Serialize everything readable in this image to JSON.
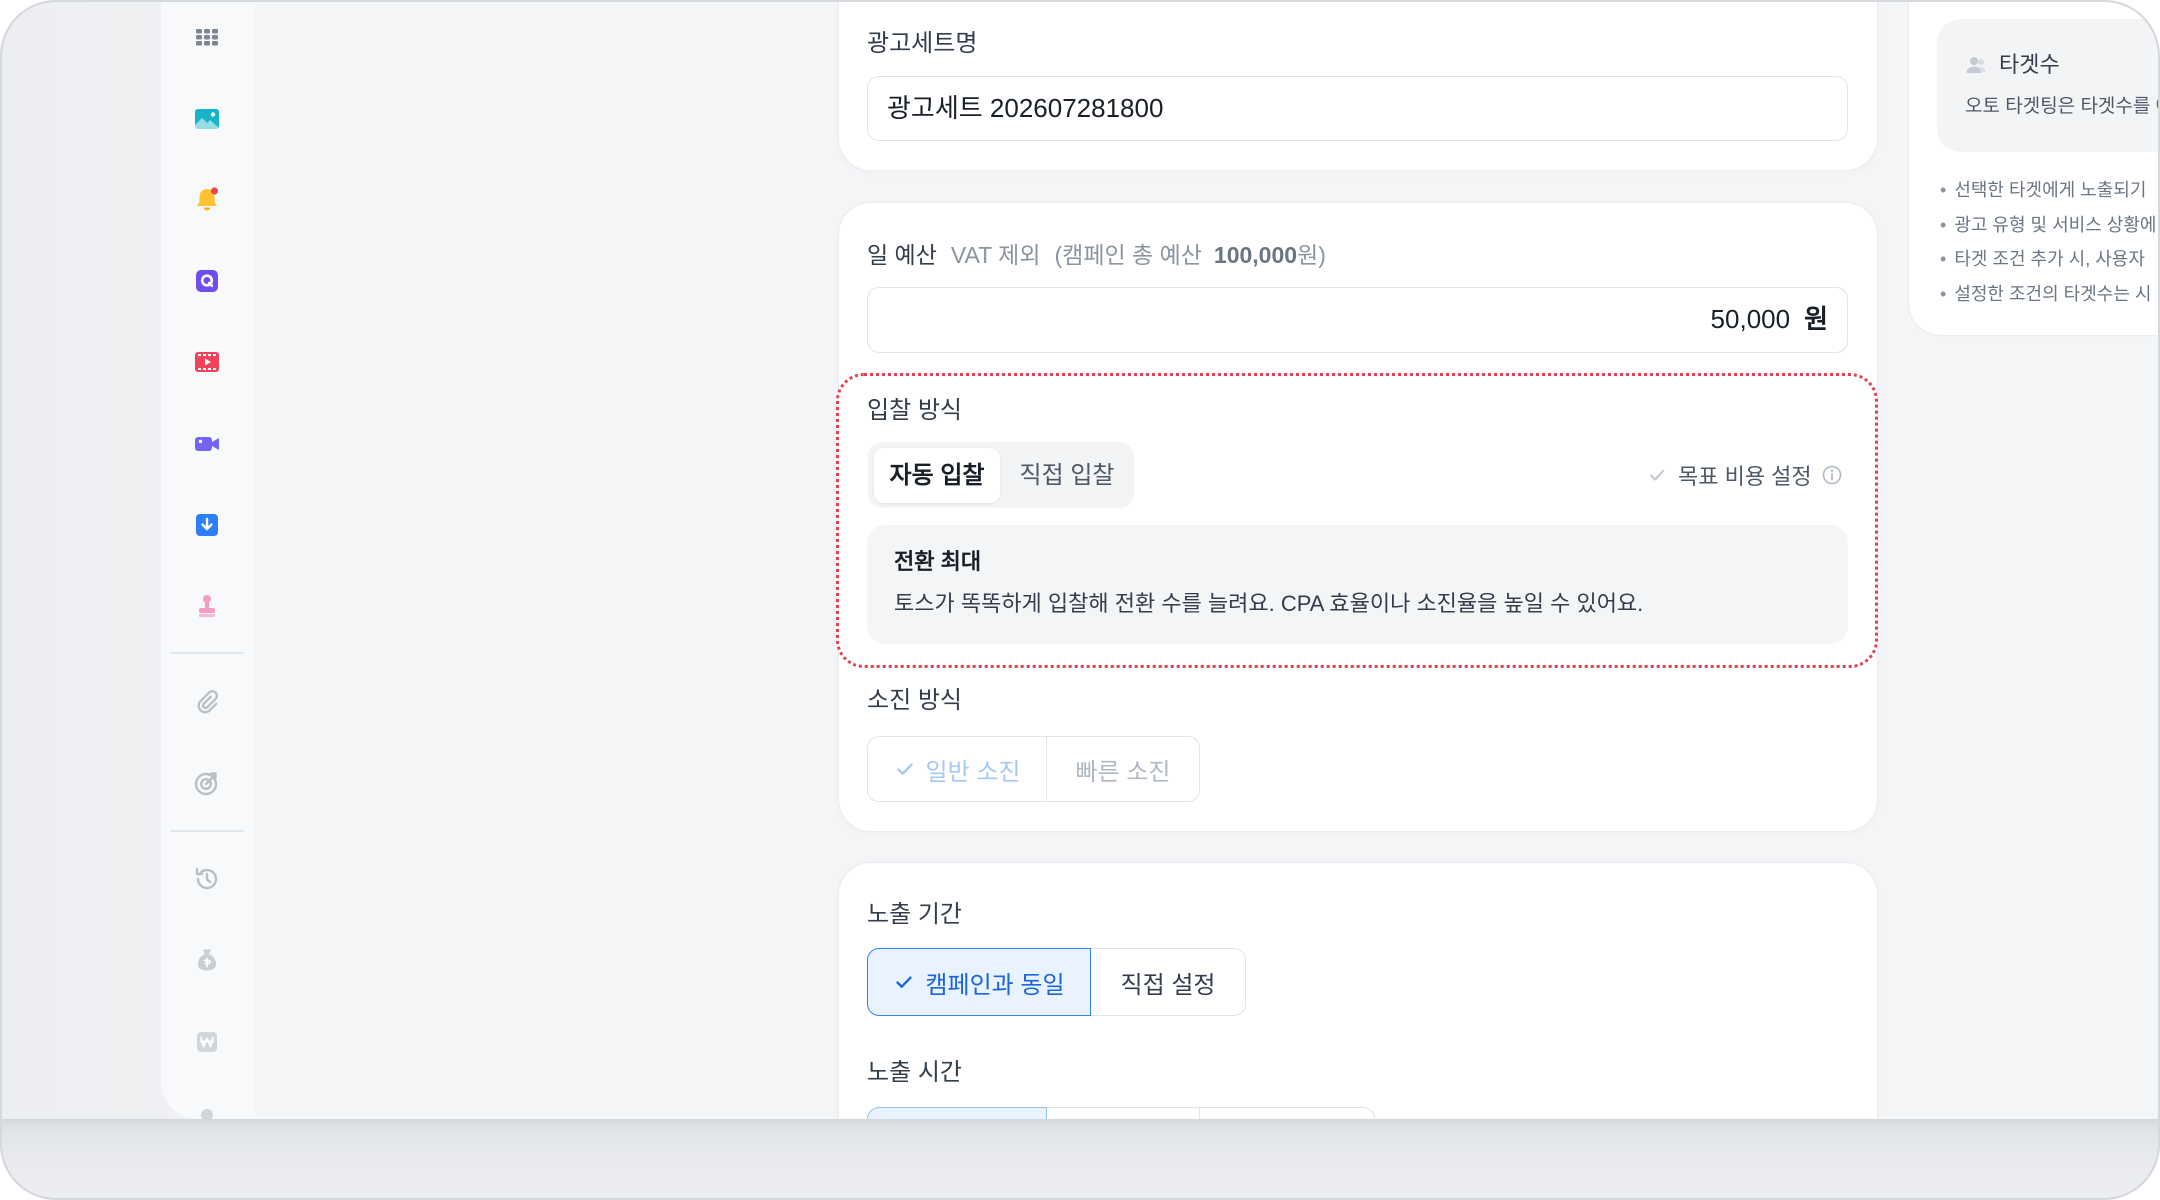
{
  "sidebar": {
    "icons": [
      "grid-icon",
      "image-icon",
      "bell-icon",
      "q-icon",
      "film-icon",
      "video-camera-icon",
      "download-icon",
      "stamp-icon",
      "paperclip-icon",
      "target-icon",
      "history-icon",
      "money-bag-icon",
      "won-icon"
    ]
  },
  "adset_name": {
    "label": "광고세트명",
    "value": "광고세트 202607281800"
  },
  "budget": {
    "label": "일 예산",
    "vat": "VAT 제외",
    "total_prefix": "(캠페인 총 예산",
    "total_amount": "100,000",
    "total_suffix": "원)",
    "value": "50,000",
    "unit": "원"
  },
  "bidding": {
    "label": "입찰 방식",
    "options": [
      "자동 입찰",
      "직접 입찰"
    ],
    "selected": "자동 입찰",
    "target_cost": "목표 비용 설정",
    "info_title": "전환 최대",
    "info_desc": "토스가 똑똑하게 입찰해 전환 수를 늘려요. CPA 효율이나 소진율을 높일 수 있어요."
  },
  "pacing": {
    "label": "소진 방식",
    "options": [
      "일반 소진",
      "빠른 소진"
    ],
    "selected": "일반 소진"
  },
  "schedule": {
    "period_label": "노출 기간",
    "period_options": [
      "캠페인과 동일",
      "직접 설정"
    ],
    "period_selected": "캠페인과 동일",
    "time_label": "노출 시간"
  },
  "side_panel": {
    "title": "타겟수",
    "desc": "오토 타겟팅은 타겟수를 예",
    "bullets": [
      "선택한 타겟에게 노출되기",
      "광고 유형 및 서비스 상황에",
      "타겟 조건 추가 시, 사용자",
      "설정한 조건의 타겟수는 시"
    ]
  },
  "colors": {
    "accent": "#3182f6",
    "accent_bg": "#e8f3ff",
    "highlight_border": "#e2414d",
    "card": "#ffffff",
    "background": "#f4f5f7"
  }
}
